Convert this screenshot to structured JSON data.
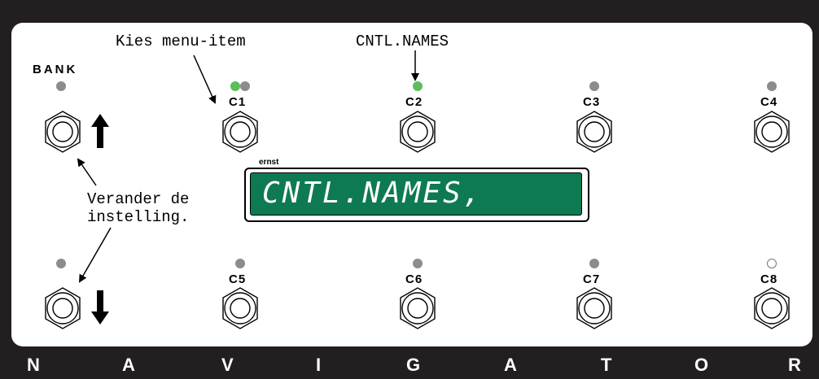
{
  "panel_bg": "#231f20",
  "lcd_color": "#0e7a52",
  "led_active_color": "#5cbd5c",
  "annotations": {
    "menu_item": "Kies menu-item",
    "cntl_names": "CNTL.NAMES",
    "change_line1": "Verander de",
    "change_line2": "instelling."
  },
  "bank_label": "BANK",
  "switch_labels": [
    "C1",
    "C2",
    "C3",
    "C4",
    "C5",
    "C6",
    "C7",
    "C8"
  ],
  "lcd": {
    "tag": "ernst",
    "text": "CNTL.NAMES,"
  },
  "brand_letters": [
    "N",
    "A",
    "V",
    "I",
    "G",
    "A",
    "T",
    "O",
    "R"
  ],
  "icons": {
    "up": "arrow-up-icon",
    "down": "arrow-down-icon"
  }
}
